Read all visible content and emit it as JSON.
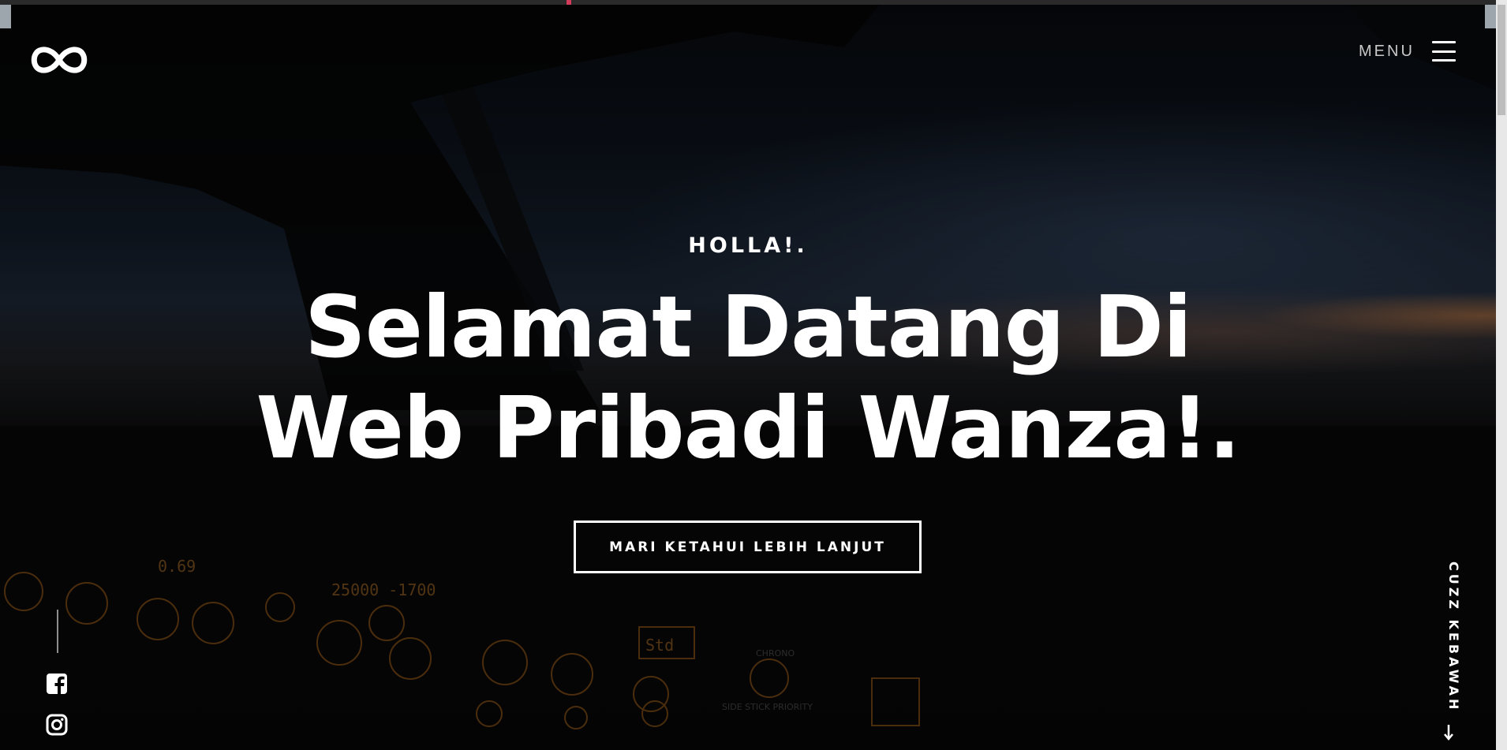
{
  "header": {
    "logo_icon": "infinity-icon",
    "menu_label": "MENU",
    "menu_icon": "hamburger-icon"
  },
  "hero": {
    "pre_title": "HOLLA!.",
    "title_line1": "Selamat Datang Di",
    "title_line2": "Web Pribadi Wanza!.",
    "cta_label": "MARI KETAHUI LEBIH LANJUT",
    "background": "cockpit-dusk-photo"
  },
  "social": {
    "items": [
      {
        "name": "facebook",
        "icon": "facebook-icon"
      },
      {
        "name": "instagram",
        "icon": "instagram-icon"
      }
    ]
  },
  "scroll_hint": {
    "label": "CUZZ KEBAWAH",
    "icon": "arrow-down-icon"
  },
  "colors": {
    "text": "#ffffff",
    "menu_text": "#c8c8c8",
    "background": "#000000",
    "sunset_glow": "#c4783c"
  }
}
